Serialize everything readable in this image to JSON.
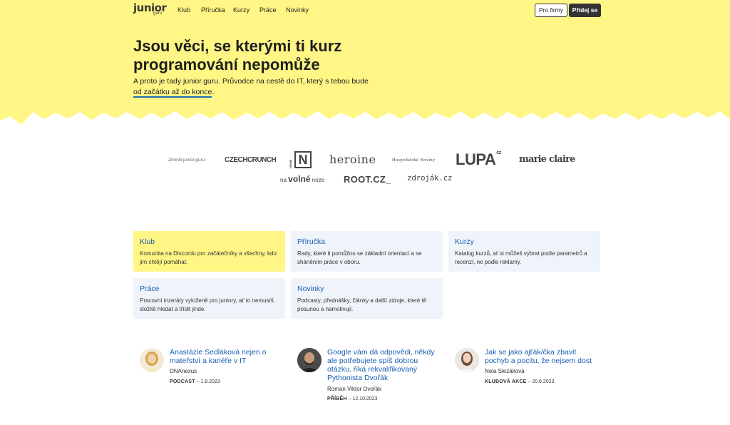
{
  "nav": {
    "logo_word": "junior",
    "logo_sub": "guru",
    "links": [
      "Klub",
      "Příručka",
      "Kurzy",
      "Práce",
      "Novinky"
    ],
    "for_companies": "Pro firmy",
    "join": "Přidej se"
  },
  "hero": {
    "title": "Jsou věci, se kterými ti kurz programování nepomůže",
    "subtitle_before": "A proto je tady junior.guru. Průvodce na cestě do IT, který s tebou bude",
    "subtitle_link": "od začátku až do konce",
    "subtitle_after": "."
  },
  "press": {
    "mentioned": "Zmínili junior.guru",
    "czechcrunch": "CZECHCRUNCH",
    "denik_vertical": "DENÍK",
    "denik_letter": "N",
    "heroine": "heroine",
    "hn": "Hospodářské Noviny",
    "lupa": "LUPA",
    "lupa_cz": "cz",
    "marieclaire": "marie claire",
    "nvn_before": "na",
    "nvn_mid": "volné",
    "nvn_after": "noze",
    "root": "ROOT.CZ_",
    "zdrojak": "zdroják.cz"
  },
  "tiles": [
    {
      "title": "Klub",
      "text": "Komunita na Discordu pro začátečníky a všechny, kdo jim chtějí pomáhat."
    },
    {
      "title": "Příručka",
      "text": "Rady, které ti pomůžou se základní orientací a se sháněním práce v oboru."
    },
    {
      "title": "Kurzy",
      "text": "Katalog kurzů, ať si můžeš vybrat podle parametrů a recenzí, ne podle reklamy."
    },
    {
      "title": "Práce",
      "text": "Pracovní inzeráty vyloženě pro juniory, ať to nemusíš složitě hledat a třídit jinde."
    },
    {
      "title": "Novinky",
      "text": "Podcasty, přednášky, články a další zdroje, které tě posunou a namotivují."
    }
  ],
  "stories": [
    {
      "title": "Anastázie Sedláková nejen o mateřství a kariéře v IT",
      "author": "DNAnexus",
      "kind": "PODCAST",
      "date": "– 1.8.2023"
    },
    {
      "title": "Google vám dá odpovědi, někdy ale potřebujete spíš dobrou otázku, říká rekvalifikovaný Pythonista Dvořák",
      "author": "Roman Viktor Dvořák",
      "kind": "PŘÍBĚH",
      "date": "– 12.10.2023"
    },
    {
      "title": "Jak se jako ajťák/čka zbavit pochyb a pocitu, že nejsem dost",
      "author": "Nela Slezáková",
      "kind": "KLUBOVÁ AKCE",
      "date": "– 20.6.2023"
    }
  ],
  "colors": {
    "brand_yellow": "#fff685",
    "link_blue": "#1a5fb4",
    "tile_bg": "#eef4fa"
  }
}
